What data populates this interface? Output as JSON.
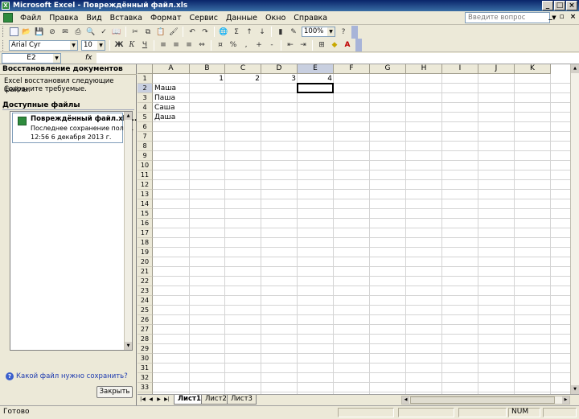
{
  "window": {
    "title": "Microsoft Excel - Повреждённый файл.xls"
  },
  "menu": {
    "items": [
      "Файл",
      "Правка",
      "Вид",
      "Вставка",
      "Формат",
      "Сервис",
      "Данные",
      "Окно",
      "Справка"
    ],
    "help_placeholder": "Введите вопрос"
  },
  "toolbar": {
    "zoom": "100%",
    "font_name": "Arial Cyr",
    "font_size": "10",
    "bold_label": "Ж",
    "italic_label": "К",
    "underline_label": "Ч"
  },
  "formula_bar": {
    "name_box": "E2",
    "fx_label": "fx",
    "content": ""
  },
  "task_pane": {
    "title": "Восстановление документов",
    "message_line1": "Excel восстановил следующие файлы.",
    "message_line2": "Сохраните требуемые.",
    "available_files_label": "Доступные файлы",
    "file": {
      "name": "Повреждённый файл.xls ...",
      "info_line1": "Последнее сохранение поль...",
      "info_line2": "12:56 6 декабря 2013 г."
    },
    "help_link": "Какой файл нужно сохранить?",
    "close_button": "Закрыть"
  },
  "sheet": {
    "columns": [
      "A",
      "B",
      "C",
      "D",
      "E",
      "F",
      "G",
      "H",
      "I",
      "J",
      "K"
    ],
    "selected_column": "E",
    "selected_row": 2,
    "row_count": 34,
    "cells": {
      "B1": "1",
      "C1": "2",
      "D1": "3",
      "E1": "4",
      "A2": "Маша",
      "A3": "Паша",
      "A4": "Саша",
      "A5": "Даша"
    },
    "tabs": [
      "Лист1",
      "Лист2",
      "Лист3"
    ],
    "active_tab": "Лист1"
  },
  "status": {
    "ready": "Готово",
    "num": "NUM"
  }
}
